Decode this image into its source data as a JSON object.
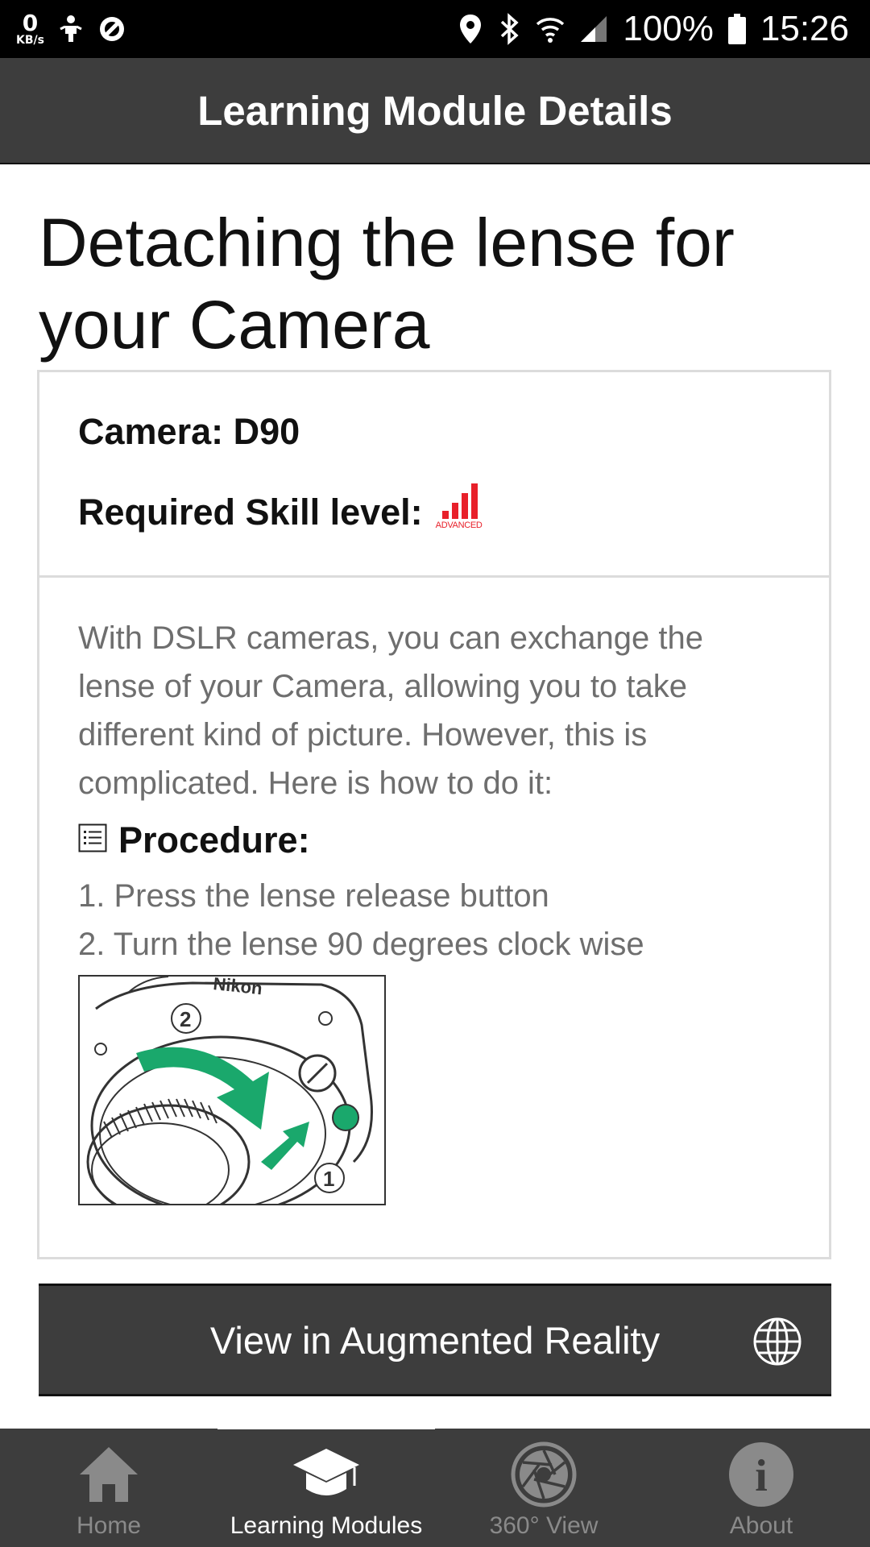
{
  "status_bar": {
    "speed_value": "0",
    "speed_unit": "KB/s",
    "battery": "100%",
    "time": "15:26"
  },
  "app_bar": {
    "title": "Learning Module Details"
  },
  "module": {
    "title": "Detaching the lense for your Camera",
    "camera_label": "Camera: D90",
    "skill_label": "Required Skill level:",
    "skill_level": "ADVANCED",
    "skill_color": "#e8202a",
    "description": "With DSLR cameras, you can exchange the lense of your Camera, allowing you to take different kind of picture. However, this is complicated. Here is how to do it:",
    "procedure_heading": "Procedure:",
    "steps": [
      "1. Press the lense release button",
      "2. Turn the lense 90 degrees clock wise"
    ],
    "illustration_text": "Nikon"
  },
  "ar_button": {
    "label": "View in Augmented Reality",
    "icon": "globe-icon"
  },
  "bottom_nav": {
    "items": [
      {
        "label": "Home",
        "icon": "home-icon"
      },
      {
        "label": "Learning Modules",
        "icon": "graduation-cap-icon"
      },
      {
        "label": "360° View",
        "icon": "aperture-icon"
      },
      {
        "label": "About",
        "icon": "info-icon"
      }
    ],
    "active_index": 1
  },
  "colors": {
    "bar": "#3d3d3d",
    "accent_green": "#1aa86c",
    "text_gray": "#6e6e6e"
  }
}
